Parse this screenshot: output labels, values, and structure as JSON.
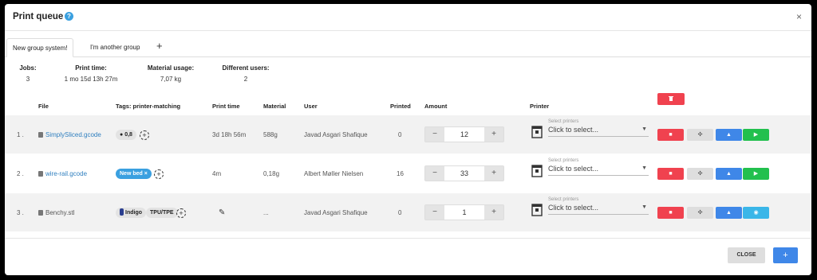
{
  "modal": {
    "title": "Print queue",
    "help_icon": "?",
    "close_icon": "×"
  },
  "tabs": [
    {
      "label": "New group system!",
      "active": true
    },
    {
      "label": "I'm another group",
      "active": false
    }
  ],
  "tab_add": "+",
  "stats": [
    {
      "label": "Jobs:",
      "value": "3"
    },
    {
      "label": "Print time:",
      "value": "1 mo 15d 13h 27m"
    },
    {
      "label": "Material usage:",
      "value": "7,07 kg"
    },
    {
      "label": "Different users:",
      "value": "2"
    }
  ],
  "columns": [
    "File",
    "Tags: printer-matching",
    "Print time",
    "Material",
    "User",
    "Printed",
    "Amount",
    "Printer"
  ],
  "select_label": "Select printers",
  "select_placeholder": "Click to select...",
  "rows": [
    {
      "index": "1 .",
      "file": "SimplySliced.gcode",
      "tags": [
        "0,8"
      ],
      "print_time": "3d 18h 56m",
      "material": "588g",
      "user": "Javad Asgari Shafique",
      "printed": "0",
      "amount": "12"
    },
    {
      "index": "2 .",
      "file": "wire-rail.gcode",
      "tags": [
        "New bed ×"
      ],
      "print_time": "4m",
      "material": "0,18g",
      "user": "Albert Møller Nielsen",
      "printed": "16",
      "amount": "33"
    },
    {
      "index": "3 .",
      "file": "Benchy.stl",
      "tags": [
        "Indigo",
        "TPU/TPE"
      ],
      "print_time": "",
      "material": "...",
      "user": "Javad Asgari Shafique",
      "printed": "0",
      "amount": "1"
    }
  ],
  "stepper": {
    "minus": "−",
    "plus": "+"
  },
  "footer": {
    "close_label": "CLOSE",
    "add_label": "+"
  },
  "colors": {
    "accent_blue": "#3f87e8",
    "danger_red": "#f0424f",
    "success_green": "#22c04e",
    "tag_blue": "#3aa0e0"
  }
}
